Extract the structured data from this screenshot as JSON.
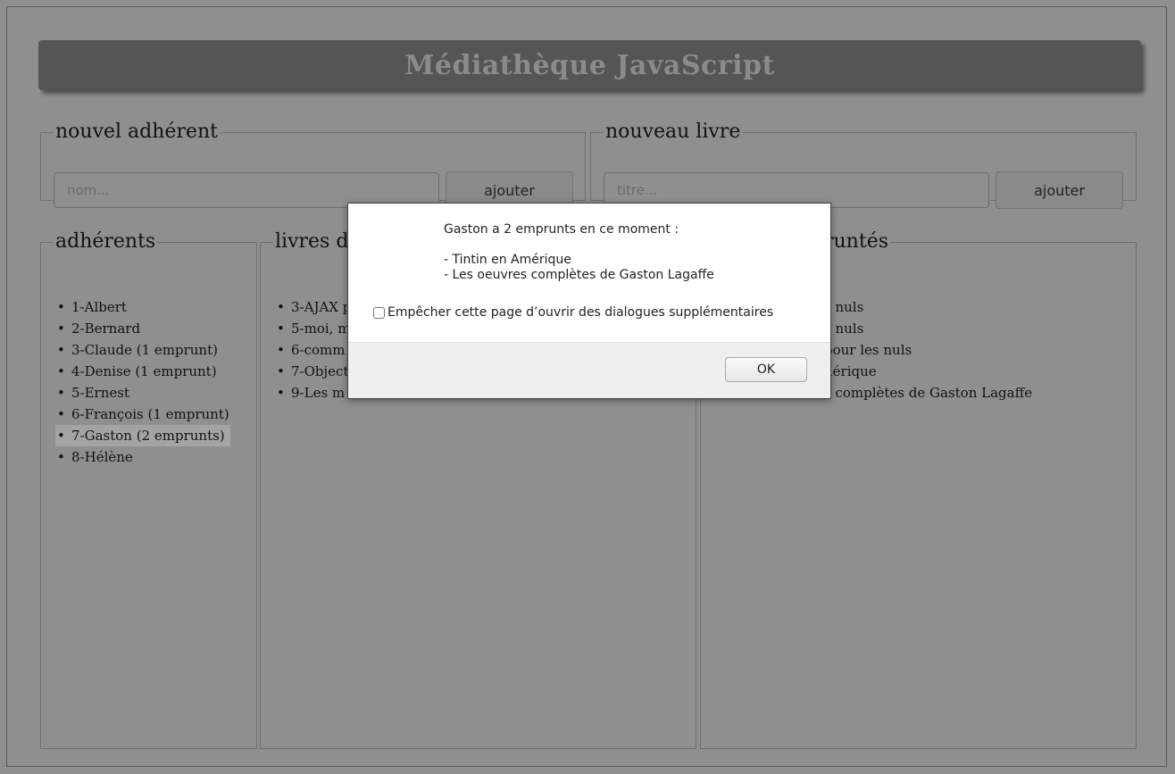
{
  "app": {
    "title": "Médiathèque JavaScript"
  },
  "new_member": {
    "legend": "nouvel adhérent",
    "placeholder": "nom...",
    "button": "ajouter"
  },
  "new_book": {
    "legend": "nouveau livre",
    "placeholder": "titre...",
    "button": "ajouter"
  },
  "members": {
    "legend": "adhérents",
    "items": [
      "1-Albert",
      "2-Bernard",
      "3-Claude (1 emprunt)",
      "4-Denise (1 emprunt)",
      "5-Ernest",
      "6-François (1 emprunt)",
      "7-Gaston (2 emprunts)",
      "8-Hélène"
    ],
    "selected_index": 6
  },
  "available_books": {
    "legend_visible": "livres d",
    "items_visible": [
      "3-AJAX p",
      "5-moi, m",
      "6-comm",
      "7-Object",
      "9-Les m"
    ]
  },
  "borrowed_books": {
    "legend_visible": "runtés",
    "items_visible": [
      "s nuls",
      "s nuls",
      "pour les nuls",
      "nérique",
      "s complètes de Gaston Lagaffe"
    ]
  },
  "dialog": {
    "message_line1": "Gaston a 2 emprunts en ce moment :",
    "message_line2": "- Tintin en Amérique",
    "message_line3": "- Les oeuvres complètes de Gaston Lagaffe",
    "checkbox_label": "Empêcher cette page d’ouvrir des dialogues supplémentaires",
    "ok_label": "OK"
  }
}
